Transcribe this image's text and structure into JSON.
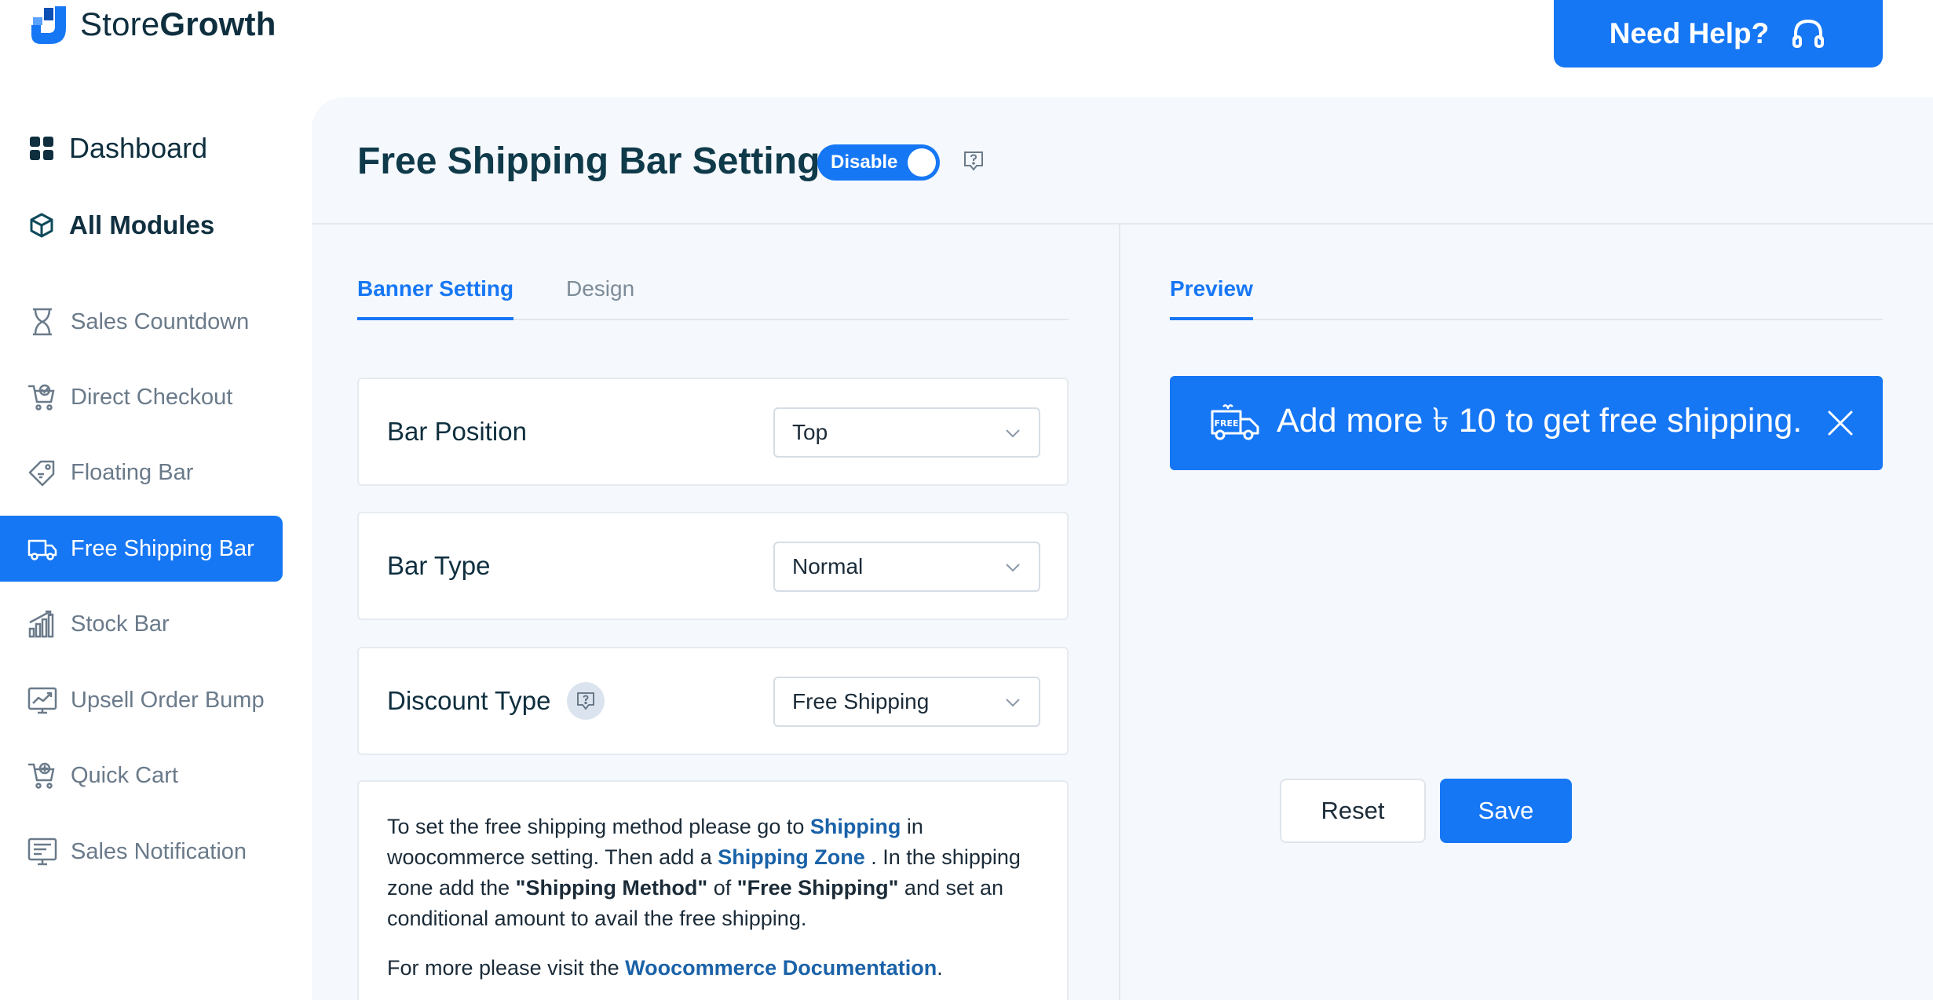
{
  "brand": {
    "name_part1": "Store",
    "name_part2": "Growth"
  },
  "header": {
    "help_label": "Need Help?"
  },
  "sidebar": {
    "dashboard": "Dashboard",
    "all_modules": "All Modules",
    "items": [
      {
        "label": "Sales Countdown",
        "icon": "hourglass-icon"
      },
      {
        "label": "Direct Checkout",
        "icon": "cart-check-icon"
      },
      {
        "label": "Floating Bar",
        "icon": "tag-icon"
      },
      {
        "label": "Free Shipping Bar",
        "icon": "truck-icon",
        "active": true
      },
      {
        "label": "Stock Bar",
        "icon": "bar-chart-icon"
      },
      {
        "label": "Upsell Order Bump",
        "icon": "trend-chart-icon"
      },
      {
        "label": "Quick Cart",
        "icon": "cart-icon"
      },
      {
        "label": "Sales Notification",
        "icon": "notification-icon"
      }
    ]
  },
  "main": {
    "title": "Free Shipping Bar Setting",
    "toggle_label": "Disable",
    "tabs": [
      {
        "label": "Banner Setting",
        "active": true
      },
      {
        "label": "Design",
        "active": false
      }
    ],
    "settings": [
      {
        "label": "Bar Position",
        "value": "Top"
      },
      {
        "label": "Bar Type",
        "value": "Normal"
      },
      {
        "label": "Discount Type",
        "value": "Free Shipping"
      }
    ],
    "info": {
      "p1_a": "To set the free shipping method please go to",
      "link_shipping": "Shipping",
      "p1_b": "in woocommerce setting. Then add a",
      "link_zone": "Shipping Zone",
      "p1_c": ". In the shipping zone add the",
      "method": "\"Shipping Method\"",
      "p1_d": "of",
      "free": "\"Free Shipping\"",
      "p1_e": "and set an conditional amount to avail the free shipping.",
      "p2_a": "For more please visit the",
      "link_docs": "Woocommerce Documentation",
      "p2_b": "."
    }
  },
  "preview": {
    "tab_label": "Preview",
    "banner_text": "Add more ৳ 10 to get free shipping.",
    "truck_badge": "FREE"
  },
  "actions": {
    "reset": "Reset",
    "save": "Save"
  },
  "colors": {
    "accent": "#1677f5",
    "panel_bg": "#f5f8fc",
    "text_dark": "#0f2f3f"
  }
}
